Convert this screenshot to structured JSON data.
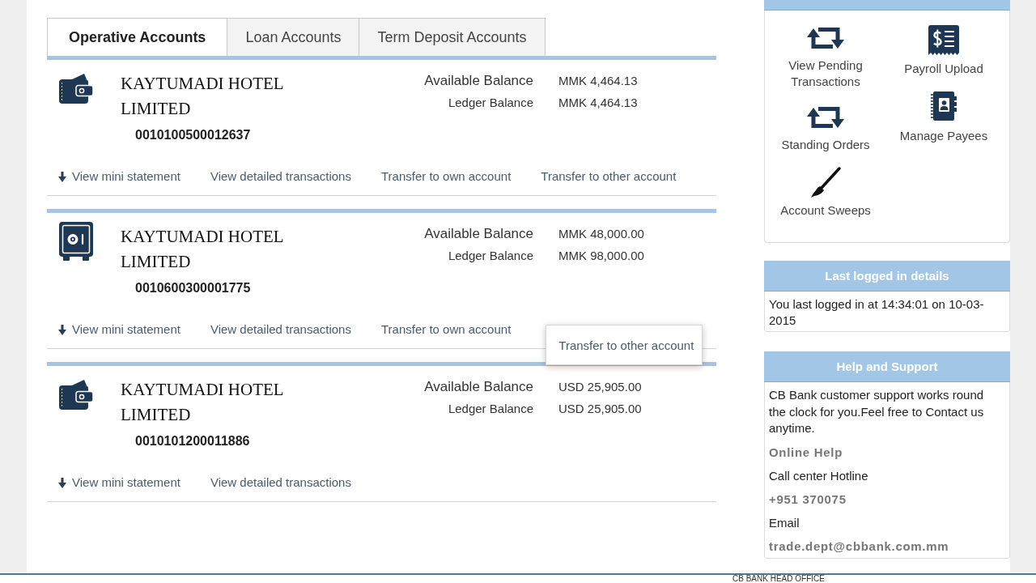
{
  "tabs": [
    {
      "label": "Operative Accounts",
      "selected": true
    },
    {
      "label": "Loan Accounts",
      "selected": false
    },
    {
      "label": "Term Deposit Accounts",
      "selected": false
    }
  ],
  "accounts": [
    {
      "kind": "wallet",
      "name": "KAYTUMADI HOTEL LIMITED",
      "number": "0010100500012637",
      "balances": [
        {
          "label": "Available Balance",
          "value": "MMK 4,464.13"
        },
        {
          "label": "Ledger Balance",
          "value": "MMK 4,464.13"
        }
      ],
      "links": [
        {
          "label": "View mini statement",
          "kind": "arrow",
          "hovered": false
        },
        {
          "label": "View detailed transactions",
          "kind": "plain",
          "hovered": false
        },
        {
          "label": "Transfer to own account",
          "kind": "plain",
          "hovered": false
        },
        {
          "label": "Transfer to other account",
          "kind": "plain",
          "hovered": false
        }
      ]
    },
    {
      "kind": "safe",
      "name": "KAYTUMADI HOTEL LIMITED",
      "number": "0010600300001775",
      "balances": [
        {
          "label": "Available Balance",
          "value": "MMK 48,000.00"
        },
        {
          "label": "Ledger Balance",
          "value": "MMK 98,000.00"
        }
      ],
      "links": [
        {
          "label": "View mini statement",
          "kind": "arrow",
          "hovered": false
        },
        {
          "label": "View detailed transactions",
          "kind": "plain",
          "hovered": false
        },
        {
          "label": "Transfer to own account",
          "kind": "plain",
          "hovered": false
        },
        {
          "label": "Transfer to other account",
          "kind": "plain",
          "hovered": true
        }
      ]
    },
    {
      "kind": "wallet",
      "name": "KAYTUMADI HOTEL LIMITED",
      "number": "0010101200011886",
      "balances": [
        {
          "label": "Available Balance",
          "value": "USD 25,905.00"
        },
        {
          "label": "Ledger Balance",
          "value": "USD 25,905.00"
        }
      ],
      "links": [
        {
          "label": "View mini statement",
          "kind": "arrow",
          "hovered": false
        },
        {
          "label": "View detailed transactions",
          "kind": "plain",
          "hovered": false
        }
      ]
    }
  ],
  "sidebar": {
    "quick_links": {
      "columns": [
        {
          "items": [
            {
              "label": "View Pending Transactions",
              "kind": "repeat"
            },
            {
              "label": "Standing Orders",
              "kind": "repeat"
            },
            {
              "label": "Account Sweeps",
              "kind": "brush"
            }
          ]
        },
        {
          "items": [
            {
              "label": "Payroll Upload",
              "kind": "receipt"
            },
            {
              "label": "Manage Payees",
              "kind": "book"
            }
          ]
        }
      ]
    },
    "last_login": {
      "title": "Last logged in details",
      "text": "You last logged in at 14:34:01 on 10-03-2015"
    },
    "help": {
      "title": "Help and Support",
      "text": "CB Bank customer support works round the clock for you.Feel free to Contact us anytime.",
      "lines": [
        {
          "text": "Online Help",
          "kind": "link"
        },
        {
          "text": "Call center Hotline",
          "kind": "label"
        },
        {
          "text": "+951 370075",
          "kind": "link"
        },
        {
          "text": "Email",
          "kind": "label"
        },
        {
          "text": "trade.dept@cbbank.com.mm",
          "kind": "link"
        }
      ]
    }
  },
  "footer": {
    "text": "CB BANK HEAD OFFICE"
  }
}
